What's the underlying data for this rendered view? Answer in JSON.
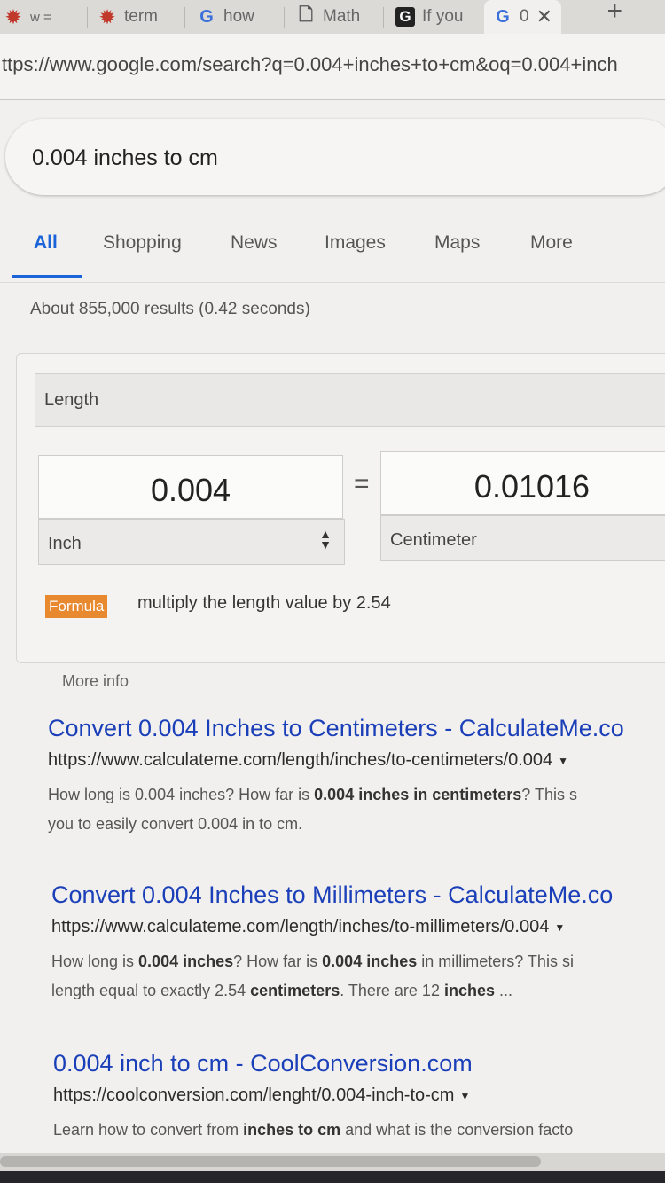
{
  "tabs": [
    {
      "label": "w =",
      "icon": "gear-icon"
    },
    {
      "label": "term",
      "icon": "gear-icon"
    },
    {
      "label": "how",
      "icon": "google-g-icon"
    },
    {
      "label": "Math",
      "icon": "document-icon"
    },
    {
      "label": "If you",
      "icon": "grammarly-icon"
    },
    {
      "label": "0",
      "icon": "google-g-icon"
    }
  ],
  "address_bar": {
    "url": "ttps://www.google.com/search?q=0.004+inches+to+cm&oq=0.004+inch"
  },
  "search": {
    "query": "0.004 inches to cm"
  },
  "nav": {
    "items": [
      "All",
      "Shopping",
      "News",
      "Images",
      "Maps",
      "More"
    ],
    "active": "All"
  },
  "result_stats": "About 855,000 results (0.42 seconds)",
  "converter": {
    "category": "Length",
    "from_value": "0.004",
    "from_unit": "Inch",
    "equals": "=",
    "to_value": "0.01016",
    "to_unit": "Centimeter",
    "formula_label": "Formula",
    "formula_text": "multiply the length value by 2.54",
    "more_info": "More info"
  },
  "results": [
    {
      "title": "Convert 0.004 Inches to Centimeters - CalculateMe.co",
      "url": "https://www.calculateme.com/length/inches/to-centimeters/0.004",
      "snippet_line1_a": "How long is 0.004 inches? How far is ",
      "snippet_line1_b": "0.004 inches in centimeters",
      "snippet_line1_c": "? This s",
      "snippet_line2": "you to easily convert 0.004 in to cm."
    },
    {
      "title": "Convert 0.004 Inches to Millimeters - CalculateMe.co",
      "url": "https://www.calculateme.com/length/inches/to-millimeters/0.004",
      "snippet_line1_a": "How long is ",
      "snippet_line1_b": "0.004 inches",
      "snippet_line1_c": "? How far is ",
      "snippet_line1_d": "0.004 inches",
      "snippet_line1_e": " in millimeters? This si",
      "snippet_line2_a": "length equal to exactly 2.54 ",
      "snippet_line2_b": "centimeters",
      "snippet_line2_c": ". There are 12 ",
      "snippet_line2_d": "inches",
      "snippet_line2_e": " ..."
    },
    {
      "title": "0.004 inch to cm - CoolConversion.com",
      "url": "https://coolconversion.com/lenght/0.004-inch-to-cm",
      "snippet_line1_a": "Learn how to convert from ",
      "snippet_line1_b": "inches to cm",
      "snippet_line1_c": " and what is the conversion facto"
    }
  ],
  "colors": {
    "link": "#1a3fb8",
    "active_tab": "#1a63d8",
    "formula_badge": "#e8882f"
  }
}
